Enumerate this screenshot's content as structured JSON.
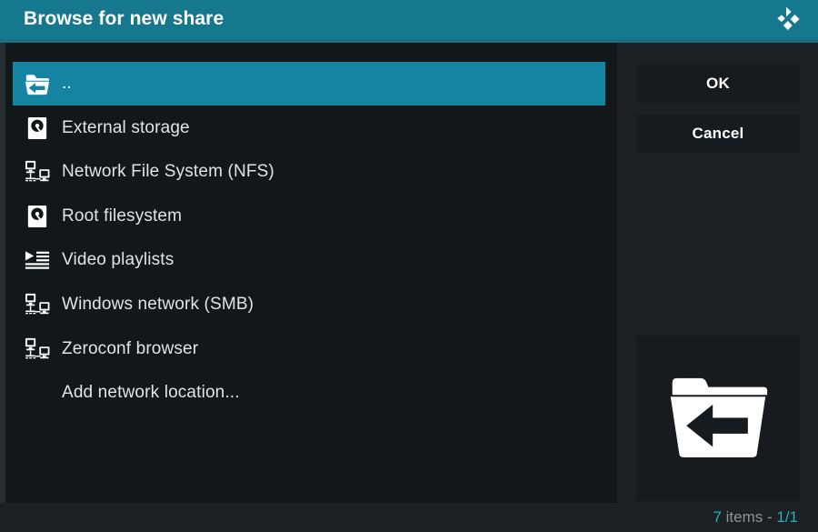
{
  "window": {
    "title": "Browse for new share",
    "logo_icon": "kodi-logo-icon",
    "accent_color": "#16788f",
    "selection_color": "#1583a2",
    "panel_background": "#1b2124",
    "list_background": "#12181a"
  },
  "list": {
    "items": [
      {
        "label": "..",
        "icon": "folder-parent-icon",
        "selected": true
      },
      {
        "label": "External storage",
        "icon": "hard-drive-icon",
        "selected": false
      },
      {
        "label": "Network File System (NFS)",
        "icon": "network-icon",
        "selected": false
      },
      {
        "label": "Root filesystem",
        "icon": "hard-drive-icon",
        "selected": false
      },
      {
        "label": "Video playlists",
        "icon": "playlist-icon",
        "selected": false
      },
      {
        "label": "Windows network (SMB)",
        "icon": "network-icon",
        "selected": false
      },
      {
        "label": "Zeroconf browser",
        "icon": "network-icon",
        "selected": false
      },
      {
        "label": "Add network location...",
        "icon": "none",
        "selected": false
      }
    ]
  },
  "buttons": {
    "ok_label": "OK",
    "cancel_label": "Cancel"
  },
  "preview": {
    "icon": "folder-parent-icon"
  },
  "status": {
    "item_count": "7",
    "item_count_label": " items - ",
    "page": "1/1",
    "count_color": "#2fabc4"
  }
}
